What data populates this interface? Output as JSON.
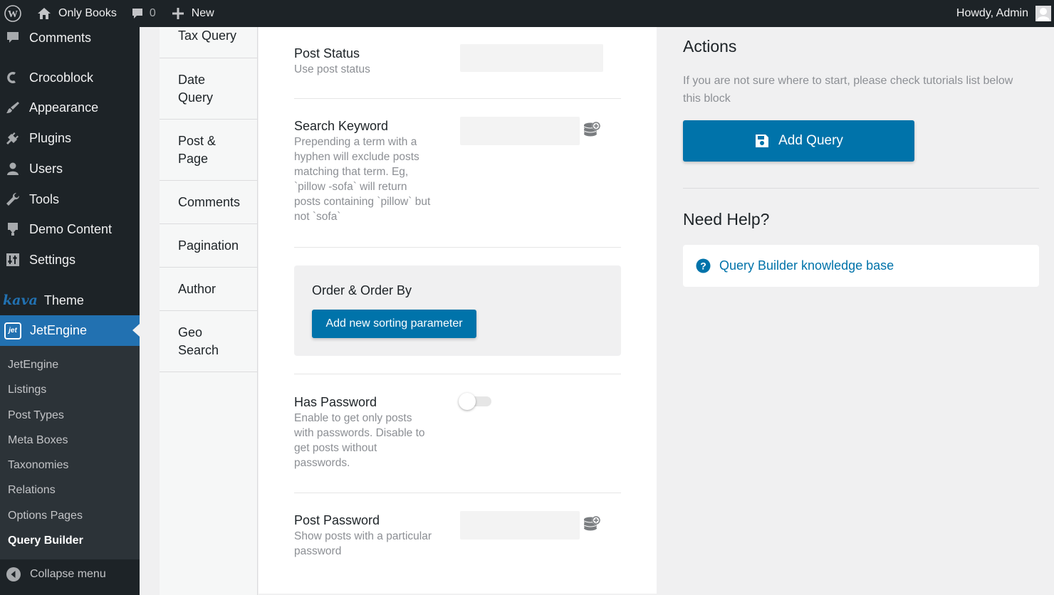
{
  "adminbar": {
    "site_name": "Only Books",
    "comments_count": "0",
    "new_label": "New",
    "howdy": "Howdy, Admin"
  },
  "sidebar": {
    "items": [
      {
        "label": "Comments",
        "icon": "comment-icon"
      },
      {
        "label": "Crocoblock",
        "icon": "crocoblock-icon"
      },
      {
        "label": "Appearance",
        "icon": "paintbrush-icon"
      },
      {
        "label": "Plugins",
        "icon": "plug-icon"
      },
      {
        "label": "Users",
        "icon": "user-icon"
      },
      {
        "label": "Tools",
        "icon": "wrench-icon"
      },
      {
        "label": "Demo Content",
        "icon": "download-icon"
      },
      {
        "label": "Settings",
        "icon": "settings-icon"
      }
    ],
    "kava_brand": "kava",
    "theme_label": "Theme",
    "current": {
      "label": "JetEngine",
      "icon": "jet-icon",
      "icon_text": "jet"
    },
    "submenu": [
      "JetEngine",
      "Listings",
      "Post Types",
      "Meta Boxes",
      "Taxonomies",
      "Relations",
      "Options Pages",
      "Query Builder"
    ],
    "active_submenu": "Query Builder",
    "collapse_label": "Collapse menu"
  },
  "tabs": [
    "Tax Query",
    "Date Query",
    "Post & Page",
    "Comments",
    "Pagination",
    "Author",
    "Geo Search"
  ],
  "main": {
    "post_status": {
      "label": "Post Status",
      "desc": "Use post status",
      "value": ""
    },
    "search_keyword": {
      "label": "Search Keyword",
      "desc": "Prepending a term with a hyphen will exclude posts matching that term. Eg, `pillow -sofa` will return posts containing `pillow` but not `sofa`",
      "value": ""
    },
    "order": {
      "label": "Order & Order By",
      "button": "Add new sorting parameter"
    },
    "has_password": {
      "label": "Has Password",
      "desc": "Enable to get only posts with passwords. Disable to get posts without passwords.",
      "enabled": false
    },
    "post_password": {
      "label": "Post Password",
      "desc": "Show posts with a particular password",
      "value": ""
    }
  },
  "right": {
    "actions_title": "Actions",
    "actions_desc": "If you are not sure where to start, please check tutorials list below this block",
    "add_query": "Add Query",
    "help_title": "Need Help?",
    "help_link": "Query Builder knowledge base"
  },
  "colors": {
    "accent": "#2271b1",
    "button": "#0073aa",
    "sidebar_bg": "#1d2327"
  }
}
